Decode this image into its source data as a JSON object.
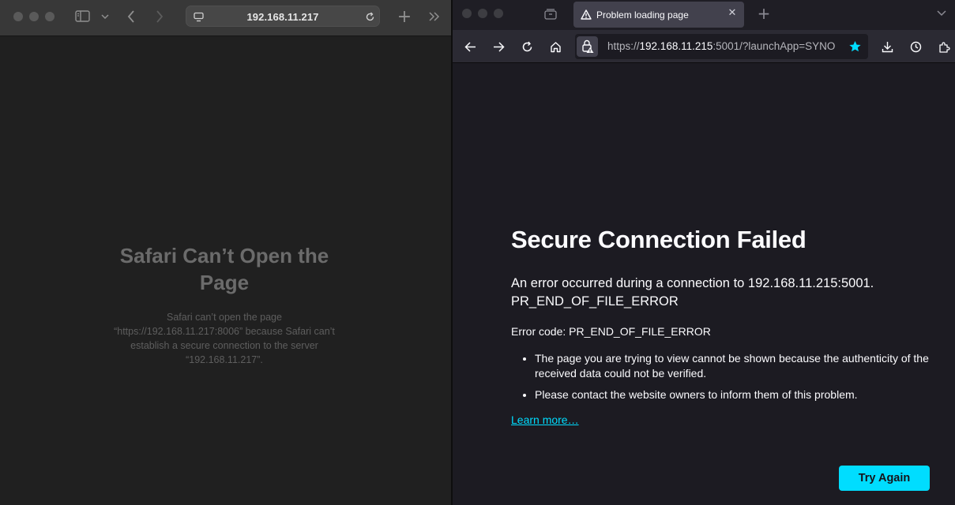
{
  "safari": {
    "address": "192.168.11.217",
    "error": {
      "title": "Safari Can’t Open the Page",
      "message": "Safari can’t open the page “https://192.168.11.217:8006” because Safari can’t establish a secure connection to the server “192.168.11.217”."
    }
  },
  "firefox": {
    "tab": {
      "title": "Problem loading page"
    },
    "url": {
      "prefix": "https://",
      "host": "192.168.11.215",
      "suffix": ":5001/?launchApp=SYNO"
    },
    "error": {
      "title": "Secure Connection Failed",
      "message_line1": "An error occurred during a connection to 192.168.11.215:5001.",
      "message_line2": "PR_END_OF_FILE_ERROR",
      "code": "Error code: PR_END_OF_FILE_ERROR",
      "bullets": [
        "The page you are trying to view cannot be shown because the authenticity of the received data could not be verified.",
        "Please contact the website owners to inform them of this problem."
      ],
      "learn_more": "Learn more…",
      "try_again": "Try Again"
    }
  },
  "colors": {
    "accent": "#00ddff",
    "ff_background": "#1c1b22",
    "safari_background": "#202020"
  }
}
